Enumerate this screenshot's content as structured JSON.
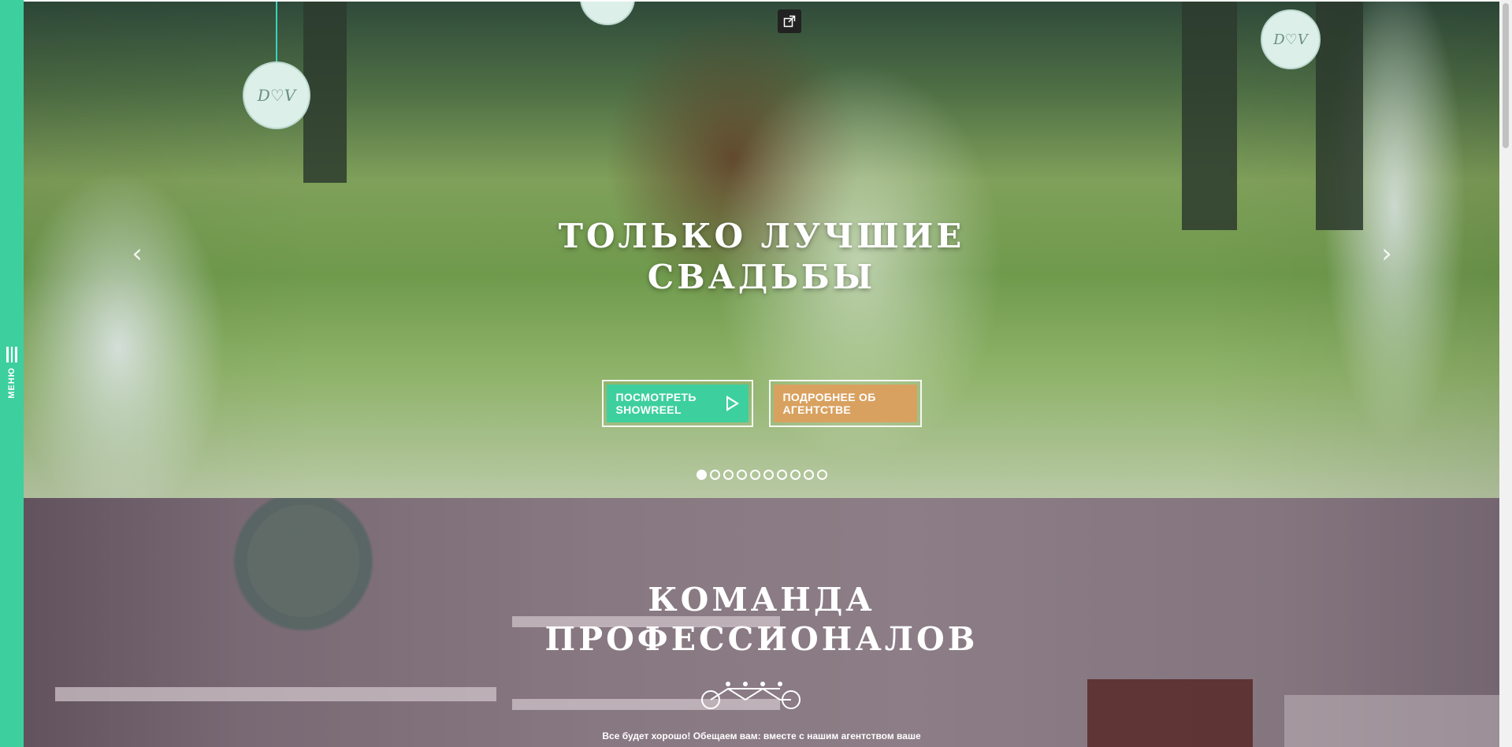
{
  "sidebar": {
    "menu_label": "МЕНЮ",
    "accent_color": "#3ecf9f",
    "menu_icon": "hamburger-icon"
  },
  "hero": {
    "title_line1": "ТОЛЬКО ЛУЧШИЕ",
    "title_line2": "СВАДЬБЫ",
    "showreel_button": "ПОСМОТРЕТЬ SHOWREEL",
    "showreel_icon": "play-icon",
    "about_button": "ПОДРОБНЕЕ ОБ АГЕНТСТВЕ",
    "button_colors": {
      "showreel": "#3ecf9f",
      "about": "#d9a15f"
    },
    "prev_arrow": "‹",
    "next_arrow": "›",
    "open_external_icon": "external-link-icon",
    "tag_text": "D♡V",
    "slides_count": 10,
    "active_slide": 1
  },
  "team": {
    "title_line1": "КОМАНДА",
    "title_line2": "ПРОФЕССИОНАЛОВ",
    "divider_icon": "tandem-bicycle-icon",
    "intro_text": "Все будет хорошо! Обещаем вам: вместе с нашим агентством ваше"
  }
}
